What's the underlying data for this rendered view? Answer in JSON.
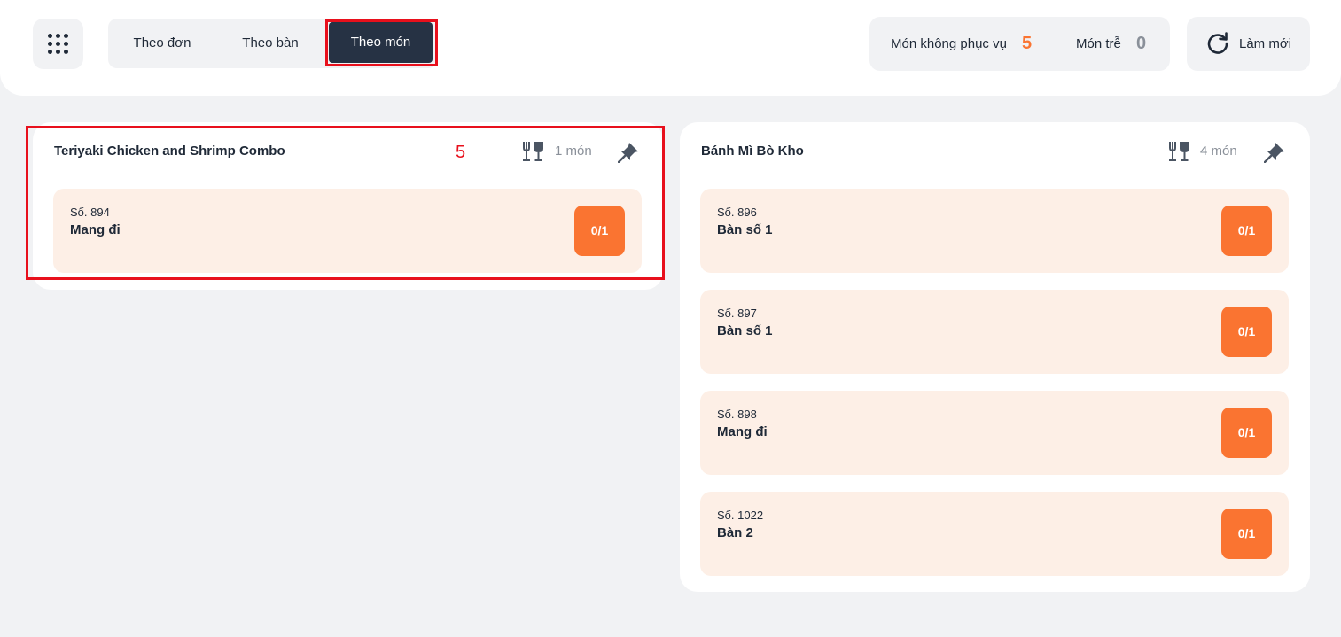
{
  "tabs": [
    {
      "label": "Theo đơn"
    },
    {
      "label": "Theo bàn"
    },
    {
      "label": "Theo món"
    }
  ],
  "stats": {
    "not_served_label": "Món không phục vụ",
    "not_served_value": "5",
    "late_label": "Món trễ",
    "late_value": "0",
    "not_served_color": "#fa7431",
    "late_color": "#8a9099"
  },
  "refresh_label": "Làm mới",
  "annotation": "5",
  "dishes": [
    {
      "title": "Teriyaki Chicken and Shrimp Combo",
      "count": "1 món",
      "orders": [
        {
          "number": "Số. 894",
          "location": "Mang đi",
          "qty": "0/1"
        }
      ]
    },
    {
      "title": "Bánh Mì Bò Kho",
      "count": "4 món",
      "orders": [
        {
          "number": "Số. 896",
          "location": "Bàn số 1",
          "qty": "0/1"
        },
        {
          "number": "Số. 897",
          "location": "Bàn số 1",
          "qty": "0/1"
        },
        {
          "number": "Số. 898",
          "location": "Mang đi",
          "qty": "0/1"
        },
        {
          "number": "Số. 1022",
          "location": "Bàn 2",
          "qty": "0/1"
        }
      ]
    }
  ],
  "colors": {
    "accent": "#fa7431",
    "active_tab": "#263244",
    "highlight": "#e8101c",
    "item_bg": "#fdefe6"
  },
  "icons": [
    "apps-grid-icon",
    "refresh-icon",
    "utensils-icon",
    "pin-icon"
  ]
}
